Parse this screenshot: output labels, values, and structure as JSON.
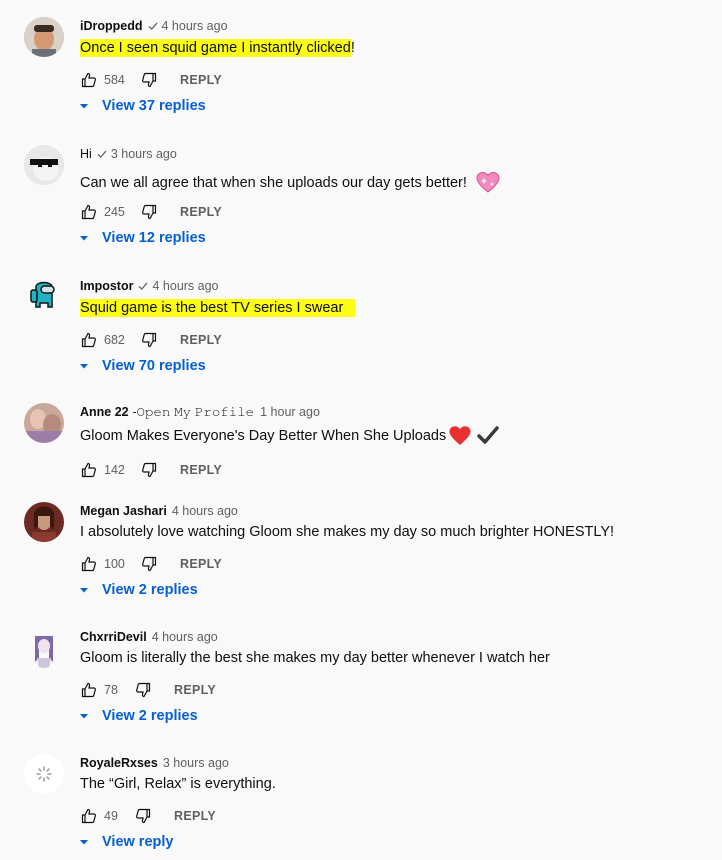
{
  "comments": [
    {
      "author": "iDroppedd",
      "time": "4 hours ago",
      "text": "Once I seen squid game I instantly clicked",
      "text_suffix": " !",
      "likes": "584",
      "reply_label": "REPLY",
      "view_replies": "View 37 replies"
    },
    {
      "author": "Hi",
      "time": "3 hours ago",
      "text": "Can we all agree that when she uploads our day gets better!",
      "likes": "245",
      "reply_label": "REPLY",
      "view_replies": "View 12 replies"
    },
    {
      "author": "Impostor",
      "time": "4 hours ago",
      "text": "Squid game is the best TV series I swear",
      "likes": "682",
      "reply_label": "REPLY",
      "view_replies": "View 70 replies"
    },
    {
      "author": "Anne 22",
      "author_suffix": " -𝙾𝚙𝚎𝚗 𝙼𝚢 𝙿𝚛𝚘𝚏𝚒𝚕𝚎",
      "time": "1 hour ago",
      "text": "Gloom Makes Everyone's Day Better When She Uploads",
      "likes": "142",
      "reply_label": "REPLY"
    },
    {
      "author": "Megan Jashari",
      "time": "4 hours ago",
      "text": "I absolutely love watching Gloom she makes my day so much brighter HONESTLY!",
      "likes": "100",
      "reply_label": "REPLY",
      "view_replies": "View 2 replies"
    },
    {
      "author": "ChxrriDevil",
      "time": "4 hours ago",
      "text": "Gloom is literally the best she makes my day better whenever I watch her",
      "likes": "78",
      "reply_label": "REPLY",
      "view_replies": "View 2 replies"
    },
    {
      "author": "RoyaleRxses",
      "time": "3 hours ago",
      "text": "The “Girl, Relax” is everything.",
      "likes": "49",
      "reply_label": "REPLY",
      "view_replies": "View reply"
    }
  ],
  "colors": {
    "highlight": "#fbfd15",
    "link": "#065fd4",
    "muted": "#606060"
  },
  "icons": {
    "like": "thumb-up-icon",
    "dislike": "thumb-down-icon",
    "verified": "check-icon",
    "expand": "caret-down-icon"
  }
}
